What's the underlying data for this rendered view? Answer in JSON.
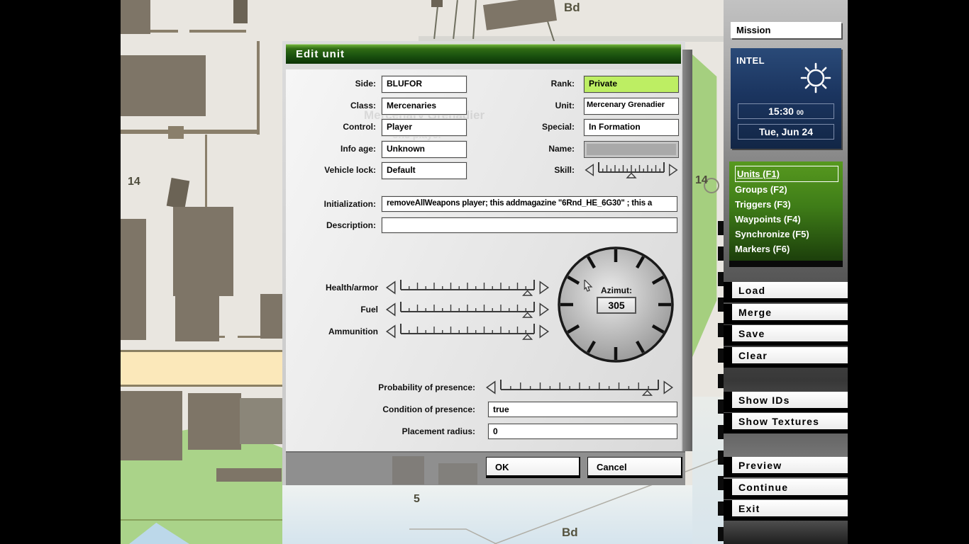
{
  "map": {
    "labels": {
      "bd_top": "Bd",
      "bd_bottom": "Bd",
      "grid_14_left": "14",
      "grid_14_right": "14",
      "grid_5": "5"
    },
    "ghost_unit_label": "Mercenary Grenadier",
    "ghost_init_fragment": "ons player"
  },
  "dialog": {
    "title": "Edit unit",
    "fields": {
      "side": {
        "label": "Side:",
        "value": "BLUFOR"
      },
      "unit_class": {
        "label": "Class:",
        "value": "Mercenaries"
      },
      "control": {
        "label": "Control:",
        "value": "Player"
      },
      "info_age": {
        "label": "Info age:",
        "value": "Unknown"
      },
      "vehicle_lock": {
        "label": "Vehicle lock:",
        "value": "Default"
      },
      "rank": {
        "label": "Rank:",
        "value": "Private"
      },
      "unit": {
        "label": "Unit:",
        "value": "Mercenary Grenadier"
      },
      "special": {
        "label": "Special:",
        "value": "In Formation"
      },
      "name": {
        "label": "Name:",
        "value": ""
      },
      "skill": {
        "label": "Skill:"
      },
      "initialization": {
        "label": "Initialization:",
        "value": "removeAllWeapons player;  this addmagazine \"6Rnd_HE_6G30\" ; this a"
      },
      "description": {
        "label": "Description:",
        "value": ""
      },
      "health": {
        "label": "Health/armor"
      },
      "fuel": {
        "label": "Fuel"
      },
      "ammunition": {
        "label": "Ammunition"
      },
      "probability": {
        "label": "Probability of presence:"
      },
      "condition": {
        "label": "Condition of presence:",
        "value": "true"
      },
      "placement": {
        "label": "Placement radius:",
        "value": "0"
      }
    },
    "azimuth": {
      "label": "Azimut:",
      "value": "305"
    },
    "buttons": {
      "ok": "OK",
      "cancel": "Cancel"
    }
  },
  "sidebar": {
    "mission_name": "Mission",
    "intel": {
      "title": "INTEL",
      "time": "15:30",
      "seconds": "00",
      "date": "Tue, Jun 24"
    },
    "menu": {
      "units": "Units (F1)",
      "groups": "Groups (F2)",
      "triggers": "Triggers (F3)",
      "waypoints": "Waypoints (F4)",
      "synchronize": "Synchronize (F5)",
      "markers": "Markers (F6)"
    },
    "buttons": {
      "load": "Load",
      "merge": "Merge",
      "save": "Save",
      "clear": "Clear",
      "show_ids": "Show IDs",
      "show_textures": "Show Textures",
      "preview": "Preview",
      "continue_": "Continue",
      "exit": "Exit"
    }
  },
  "colors": {
    "title_green": "#2f6b14",
    "rank_highlight": "#bdee63",
    "intel_blue": "#1d3b63",
    "menu_green": "#3f7d18",
    "map_land": "#e9e6e0",
    "map_building": "#7e7567",
    "map_field_yellow": "#fbe8ba",
    "map_green": "#aad389",
    "map_water": "#cfe2ee"
  }
}
